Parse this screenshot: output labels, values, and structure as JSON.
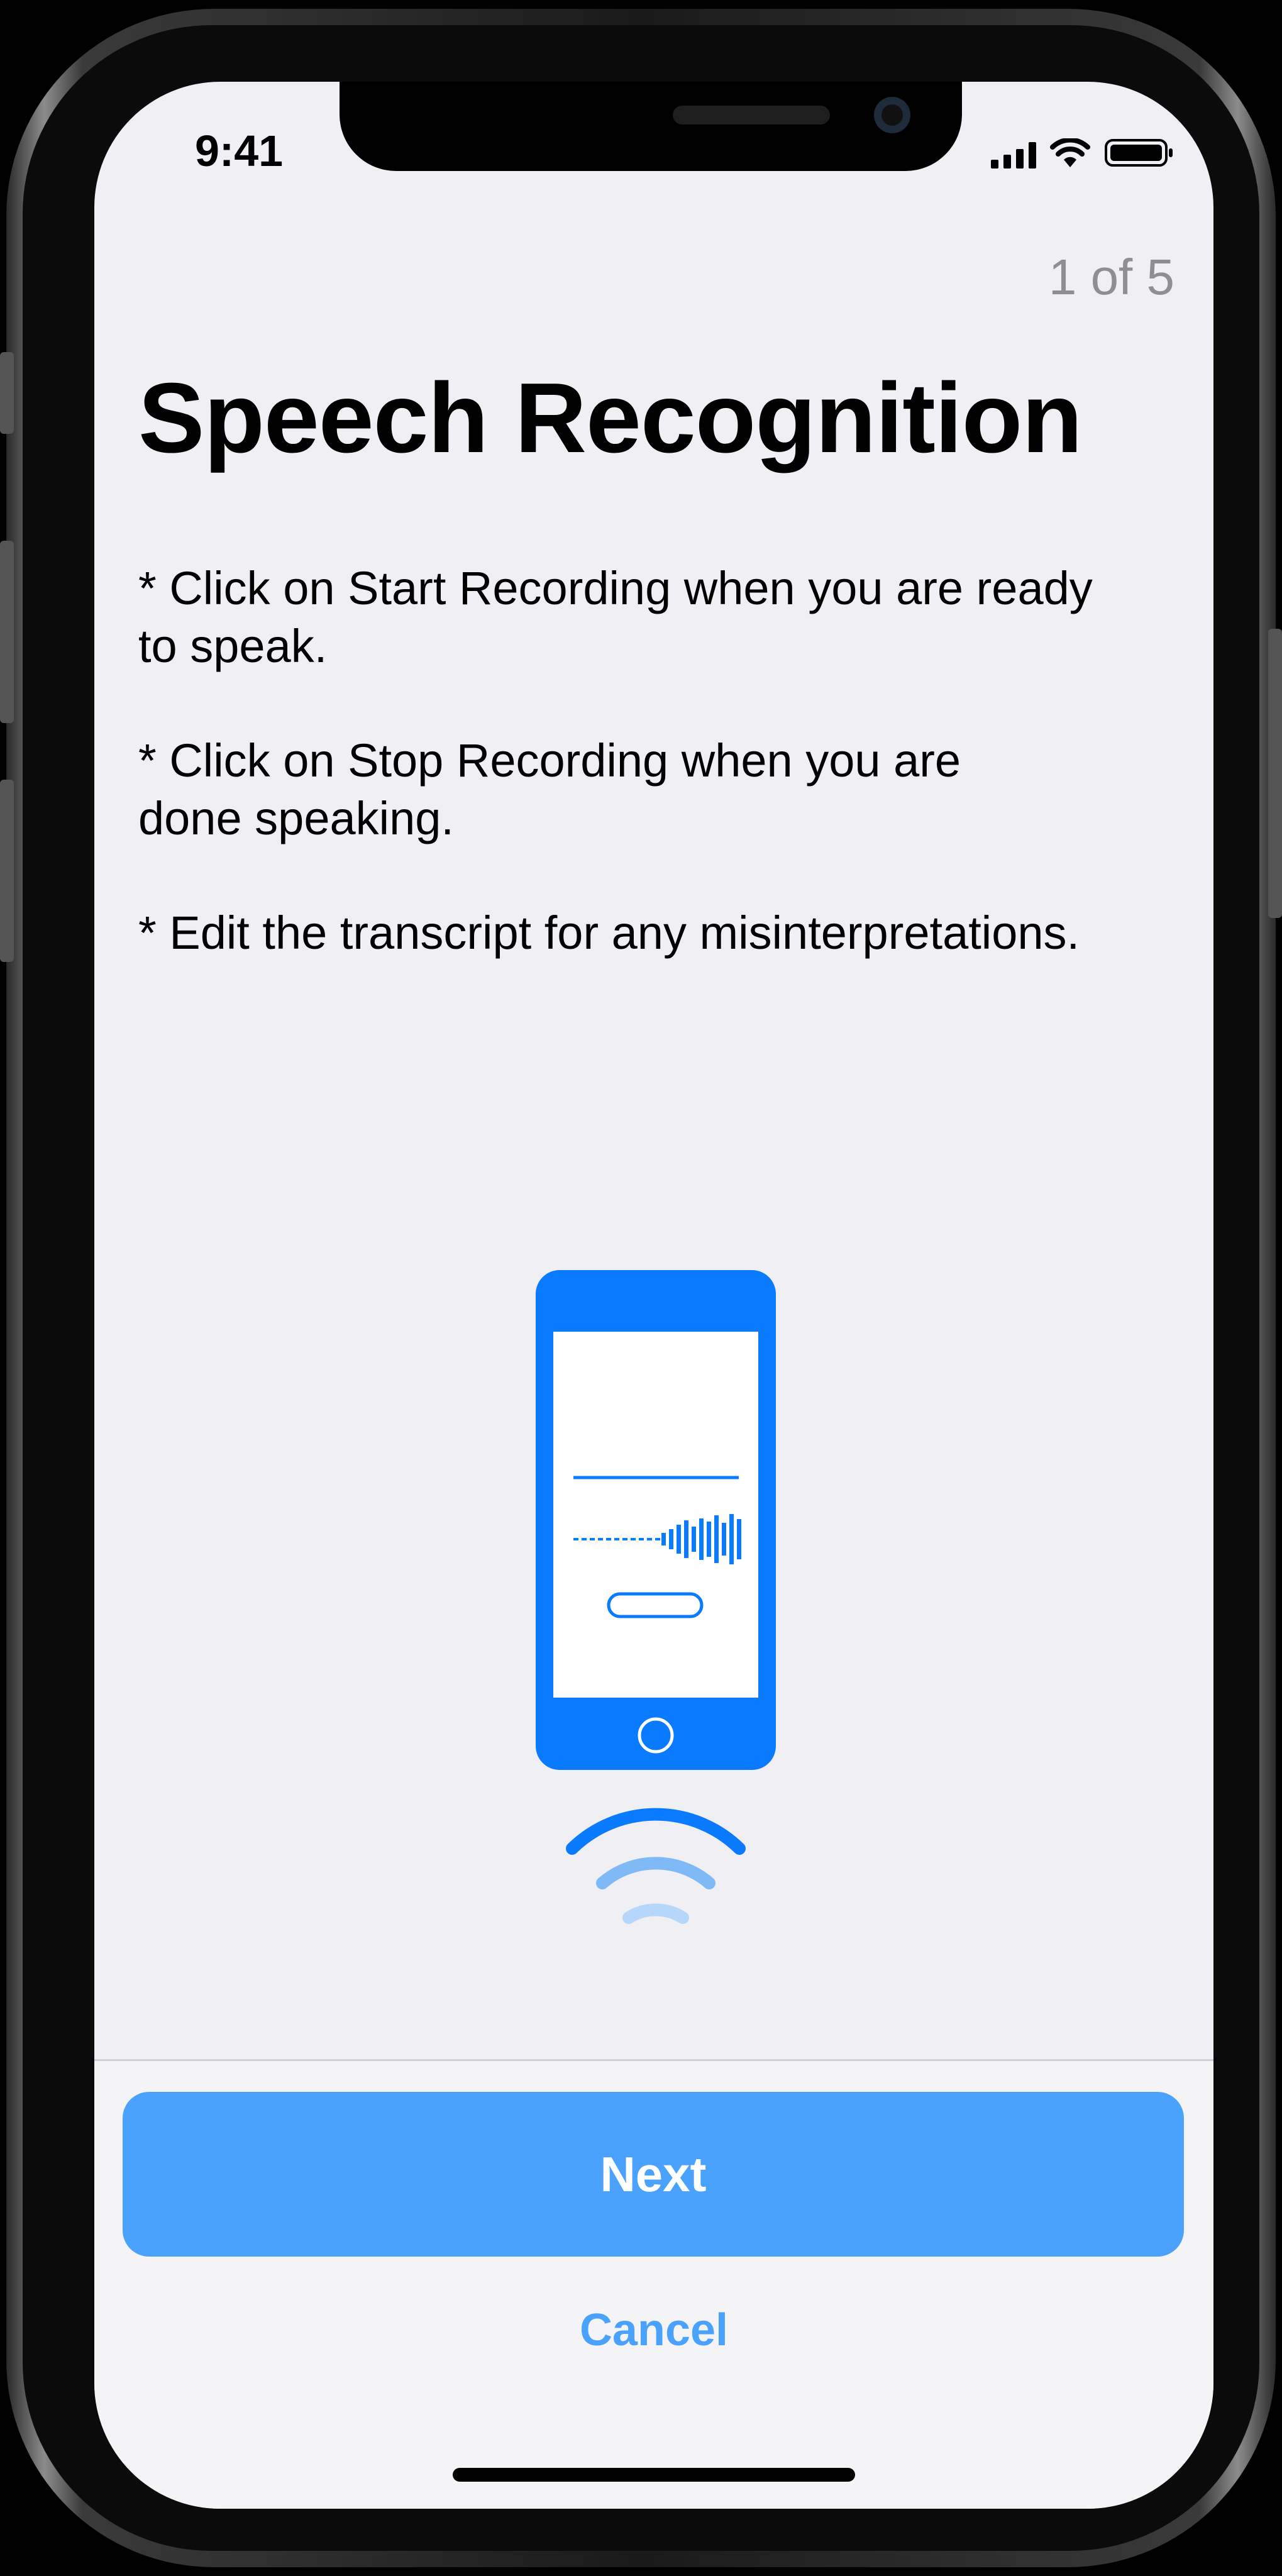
{
  "status_bar": {
    "time": "9:41"
  },
  "header": {
    "step_counter": "1 of 5",
    "title": "Speech Recognition"
  },
  "instructions": [
    "* Click on Start Recording when you are ready\nto speak.",
    "* Click on Stop Recording when you are\ndone speaking.",
    "* Edit the transcript for any misinterpretations."
  ],
  "illustration": {
    "icon": "phone-recording-illustration-icon",
    "accent_color": "#0a7aff"
  },
  "actions": {
    "next_label": "Next",
    "cancel_label": "Cancel"
  },
  "colors": {
    "accent": "#4aa2fd",
    "background": "#efeff4",
    "muted_text": "#8e8e93"
  }
}
